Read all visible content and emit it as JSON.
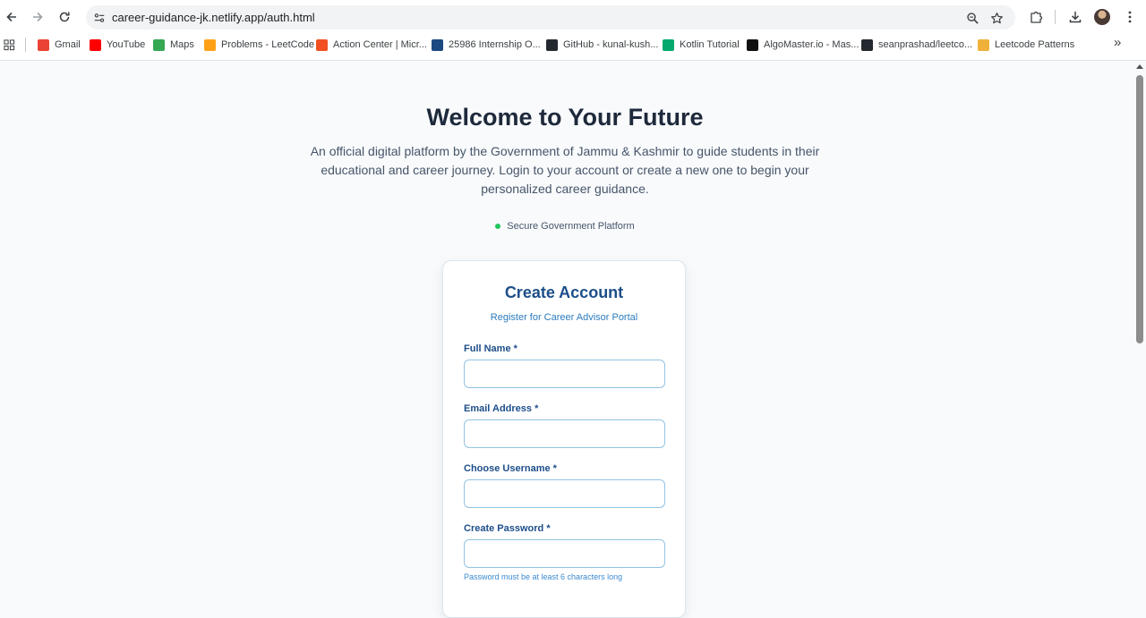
{
  "browser": {
    "url": "career-guidance-jk.netlify.app/auth.html",
    "bookmarks": [
      {
        "label": "Gmail",
        "icon": "gmail-icon",
        "color": "#ea4335"
      },
      {
        "label": "YouTube",
        "icon": "youtube-icon",
        "color": "#ff0000"
      },
      {
        "label": "Maps",
        "icon": "maps-icon",
        "color": "#34a853"
      },
      {
        "label": "Problems - LeetCode",
        "icon": "leetcode-icon",
        "color": "#ffa116"
      },
      {
        "label": "Action Center | Micr...",
        "icon": "microsoft-icon",
        "color": "#f25022"
      },
      {
        "label": "25986 Internship O...",
        "icon": "unstop-icon",
        "color": "#1c4980"
      },
      {
        "label": "GitHub - kunal-kush...",
        "icon": "github-icon",
        "color": "#24292f"
      },
      {
        "label": "Kotlin Tutorial",
        "icon": "w3schools-icon",
        "color": "#04aa6d"
      },
      {
        "label": "AlgoMaster.io - Mas...",
        "icon": "algomaster-icon",
        "color": "#111111"
      },
      {
        "label": "seanprashad/leetco...",
        "icon": "github-icon",
        "color": "#24292f"
      },
      {
        "label": "Leetcode Patterns",
        "icon": "leetcode-patterns-icon",
        "color": "#f0b13a"
      }
    ],
    "overflow_label": "»"
  },
  "hero": {
    "title": "Welcome to Your Future",
    "description": "An official digital platform by the Government of Jammu & Kashmir to guide students in their educational and career journey. Login to your account or create a new one to begin your personalized career guidance.",
    "secure_label": "Secure Government Platform"
  },
  "form": {
    "title": "Create Account",
    "subtitle": "Register for Career Advisor Portal",
    "fields": [
      {
        "label": "Full Name *",
        "value": ""
      },
      {
        "label": "Email Address *",
        "value": ""
      },
      {
        "label": "Choose Username *",
        "value": ""
      },
      {
        "label": "Create Password *",
        "value": ""
      }
    ],
    "password_hint": "Password must be at least 6 characters long"
  },
  "colors": {
    "accent": "#1d4e89",
    "secure_dot": "#22c55e",
    "input_border": "#93c3e3"
  }
}
